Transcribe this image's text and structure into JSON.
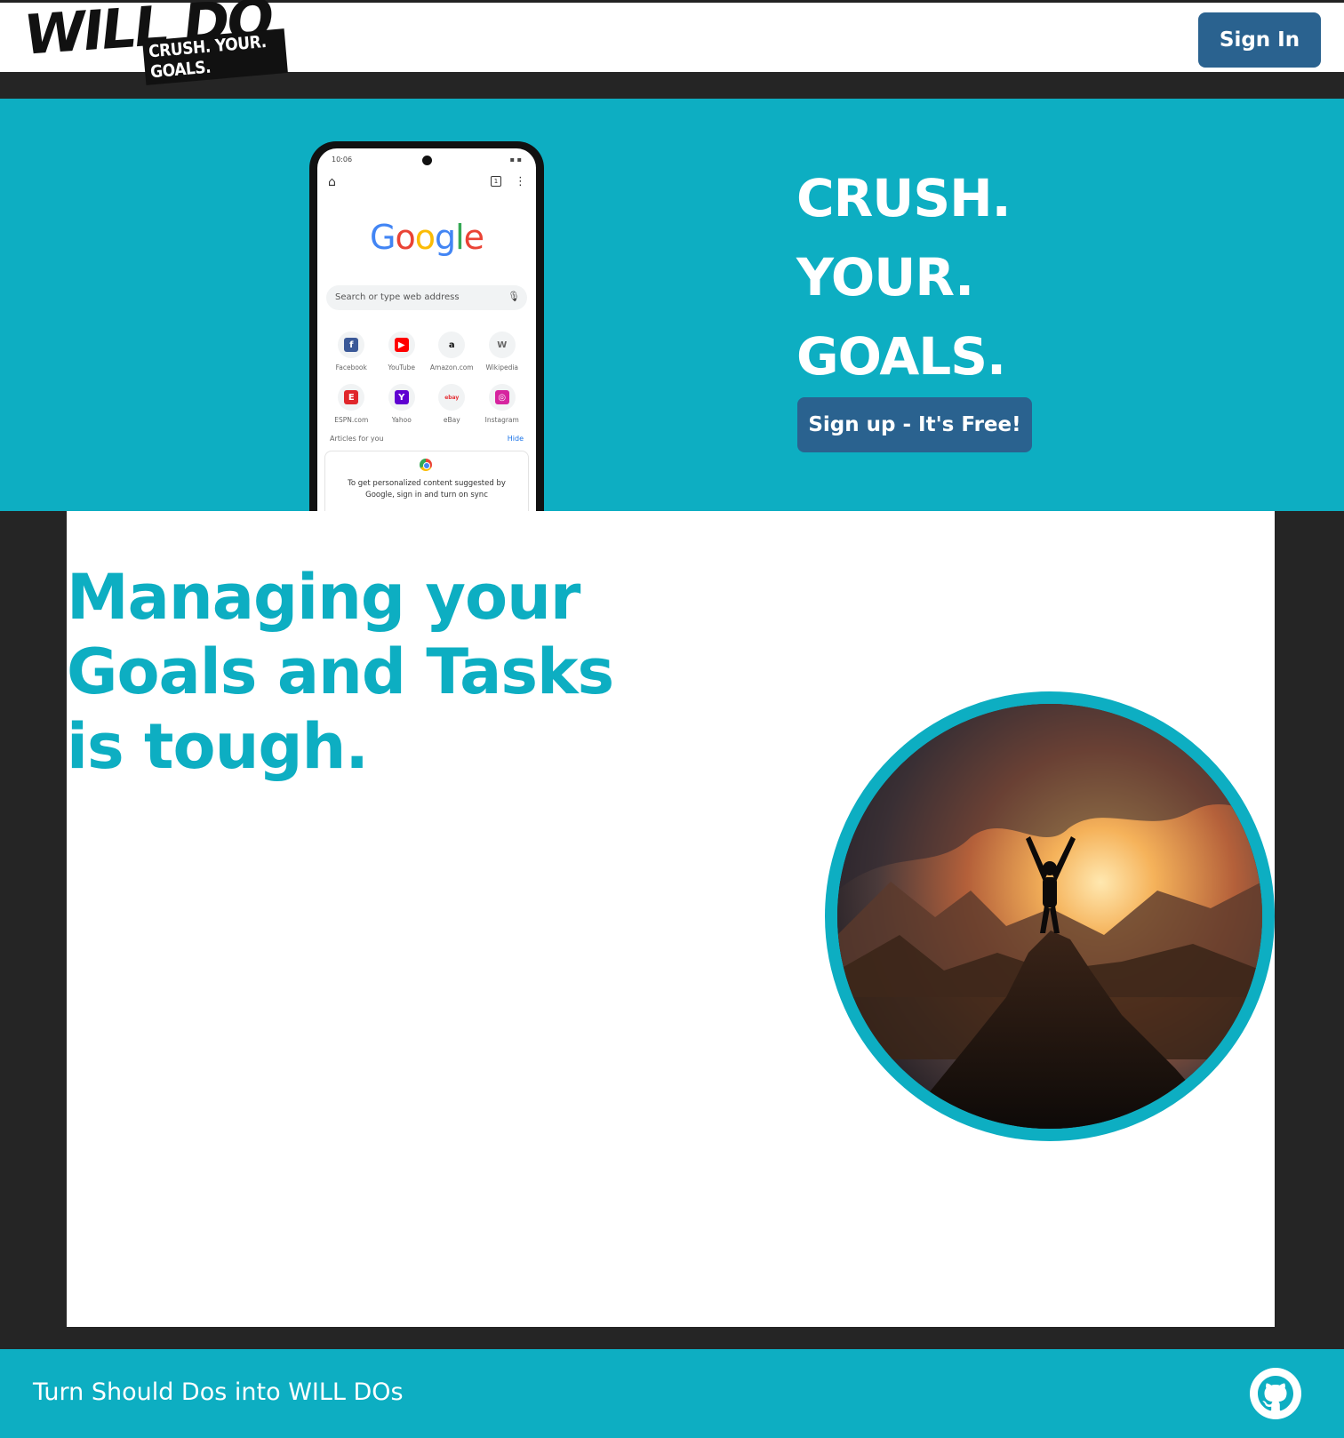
{
  "header": {
    "logo_main": "WILL DO",
    "logo_tagline": "CRUSH. YOUR. GOALS.",
    "signin_label": "Sign In"
  },
  "hero": {
    "lines": [
      "CRUSH.",
      "YOUR.",
      "GOALS."
    ],
    "signup_label": "Sign up - It's Free!"
  },
  "phone": {
    "time": "10:06",
    "google": "Google",
    "search_placeholder": "Search or type web address",
    "shortcuts": [
      {
        "label": "Facebook",
        "glyph": "f",
        "color": "#3b5998"
      },
      {
        "label": "YouTube",
        "glyph": "▶",
        "color": "#ff0000"
      },
      {
        "label": "Amazon.com",
        "glyph": "a",
        "color": "#111111"
      },
      {
        "label": "Wikipedia",
        "glyph": "W",
        "color": "#666666"
      },
      {
        "label": "ESPN.com",
        "glyph": "E",
        "color": "#e0262b"
      },
      {
        "label": "Yahoo",
        "glyph": "Y",
        "color": "#5f01d1"
      },
      {
        "label": "eBay",
        "glyph": "ebay",
        "color": "#e53238"
      },
      {
        "label": "Instagram",
        "glyph": "◎",
        "color": "#d6249f"
      }
    ],
    "articles_label": "Articles for you",
    "hide_label": "Hide",
    "sync_text": "To get personalized content suggested by Google, sign in and turn on sync"
  },
  "main": {
    "headline": "Managing your Goals and Tasks is tough."
  },
  "footer": {
    "tagline": "Turn Should Dos into WILL DOs"
  },
  "icons": {
    "github": "github-icon",
    "summit_image": "summit-image"
  },
  "colors": {
    "accent": "#0daec2",
    "button": "#2a628f",
    "background": "#252525"
  }
}
